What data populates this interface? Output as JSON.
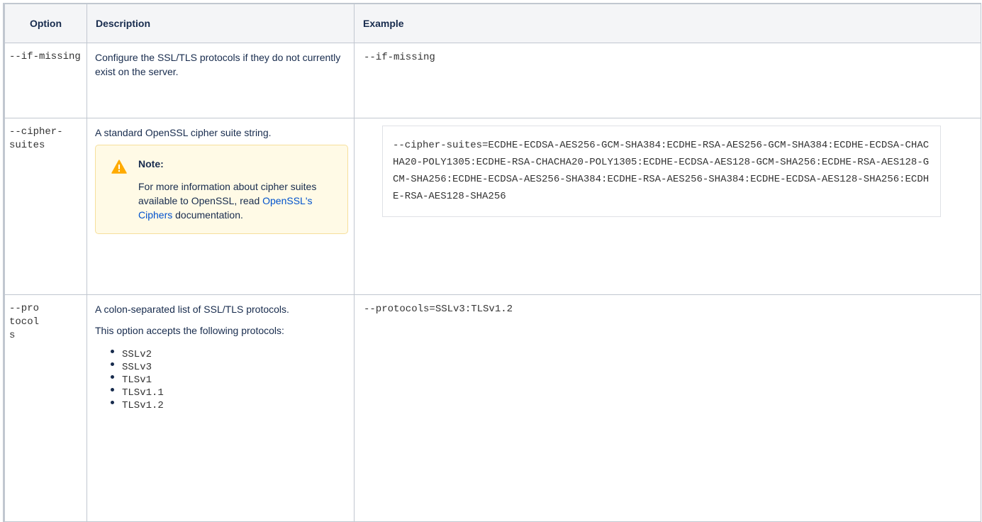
{
  "table": {
    "headers": {
      "option": "Option",
      "description": "Description",
      "example": "Example"
    },
    "rows": [
      {
        "option": "--if-missing",
        "description": "Configure the SSL/TLS protocols if they do not currently exist on the server.",
        "example": "--if-missing"
      },
      {
        "option": "--cipher-suites",
        "description": "A standard OpenSSL cipher suite string.",
        "note": {
          "title": "Note:",
          "text_before": "For more information about cipher suites available to OpenSSL, read ",
          "link": "OpenSSL's Ciphers",
          "text_after": " documentation."
        },
        "example": "--cipher-suites=ECDHE-ECDSA-AES256-GCM-SHA384:ECDHE-RSA-AES256-GCM-SHA384:ECDHE-ECDSA-CHACHA20-POLY1305:ECDHE-RSA-CHACHA20-POLY1305:ECDHE-ECDSA-AES128-GCM-SHA256:ECDHE-RSA-AES128-GCM-SHA256:ECDHE-ECDSA-AES256-SHA384:ECDHE-RSA-AES256-SHA384:ECDHE-ECDSA-AES128-SHA256:ECDHE-RSA-AES128-SHA256"
      },
      {
        "option": "--protocols",
        "description": "A colon-separated list of SSL/TLS protocols.",
        "description2": "This option accepts the following protocols:",
        "protocols": [
          "SSLv2",
          "SSLv3",
          "TLSv1",
          "TLSv1.1",
          "TLSv1.2"
        ],
        "example": "--protocols=SSLv3:TLSv1.2"
      }
    ]
  },
  "icons": {
    "note": "warning-triangle-icon"
  },
  "colors": {
    "link": "#0052cc",
    "note_bg": "#fffae6",
    "note_icon": "#ffab00",
    "header_bg": "#f4f5f7"
  }
}
